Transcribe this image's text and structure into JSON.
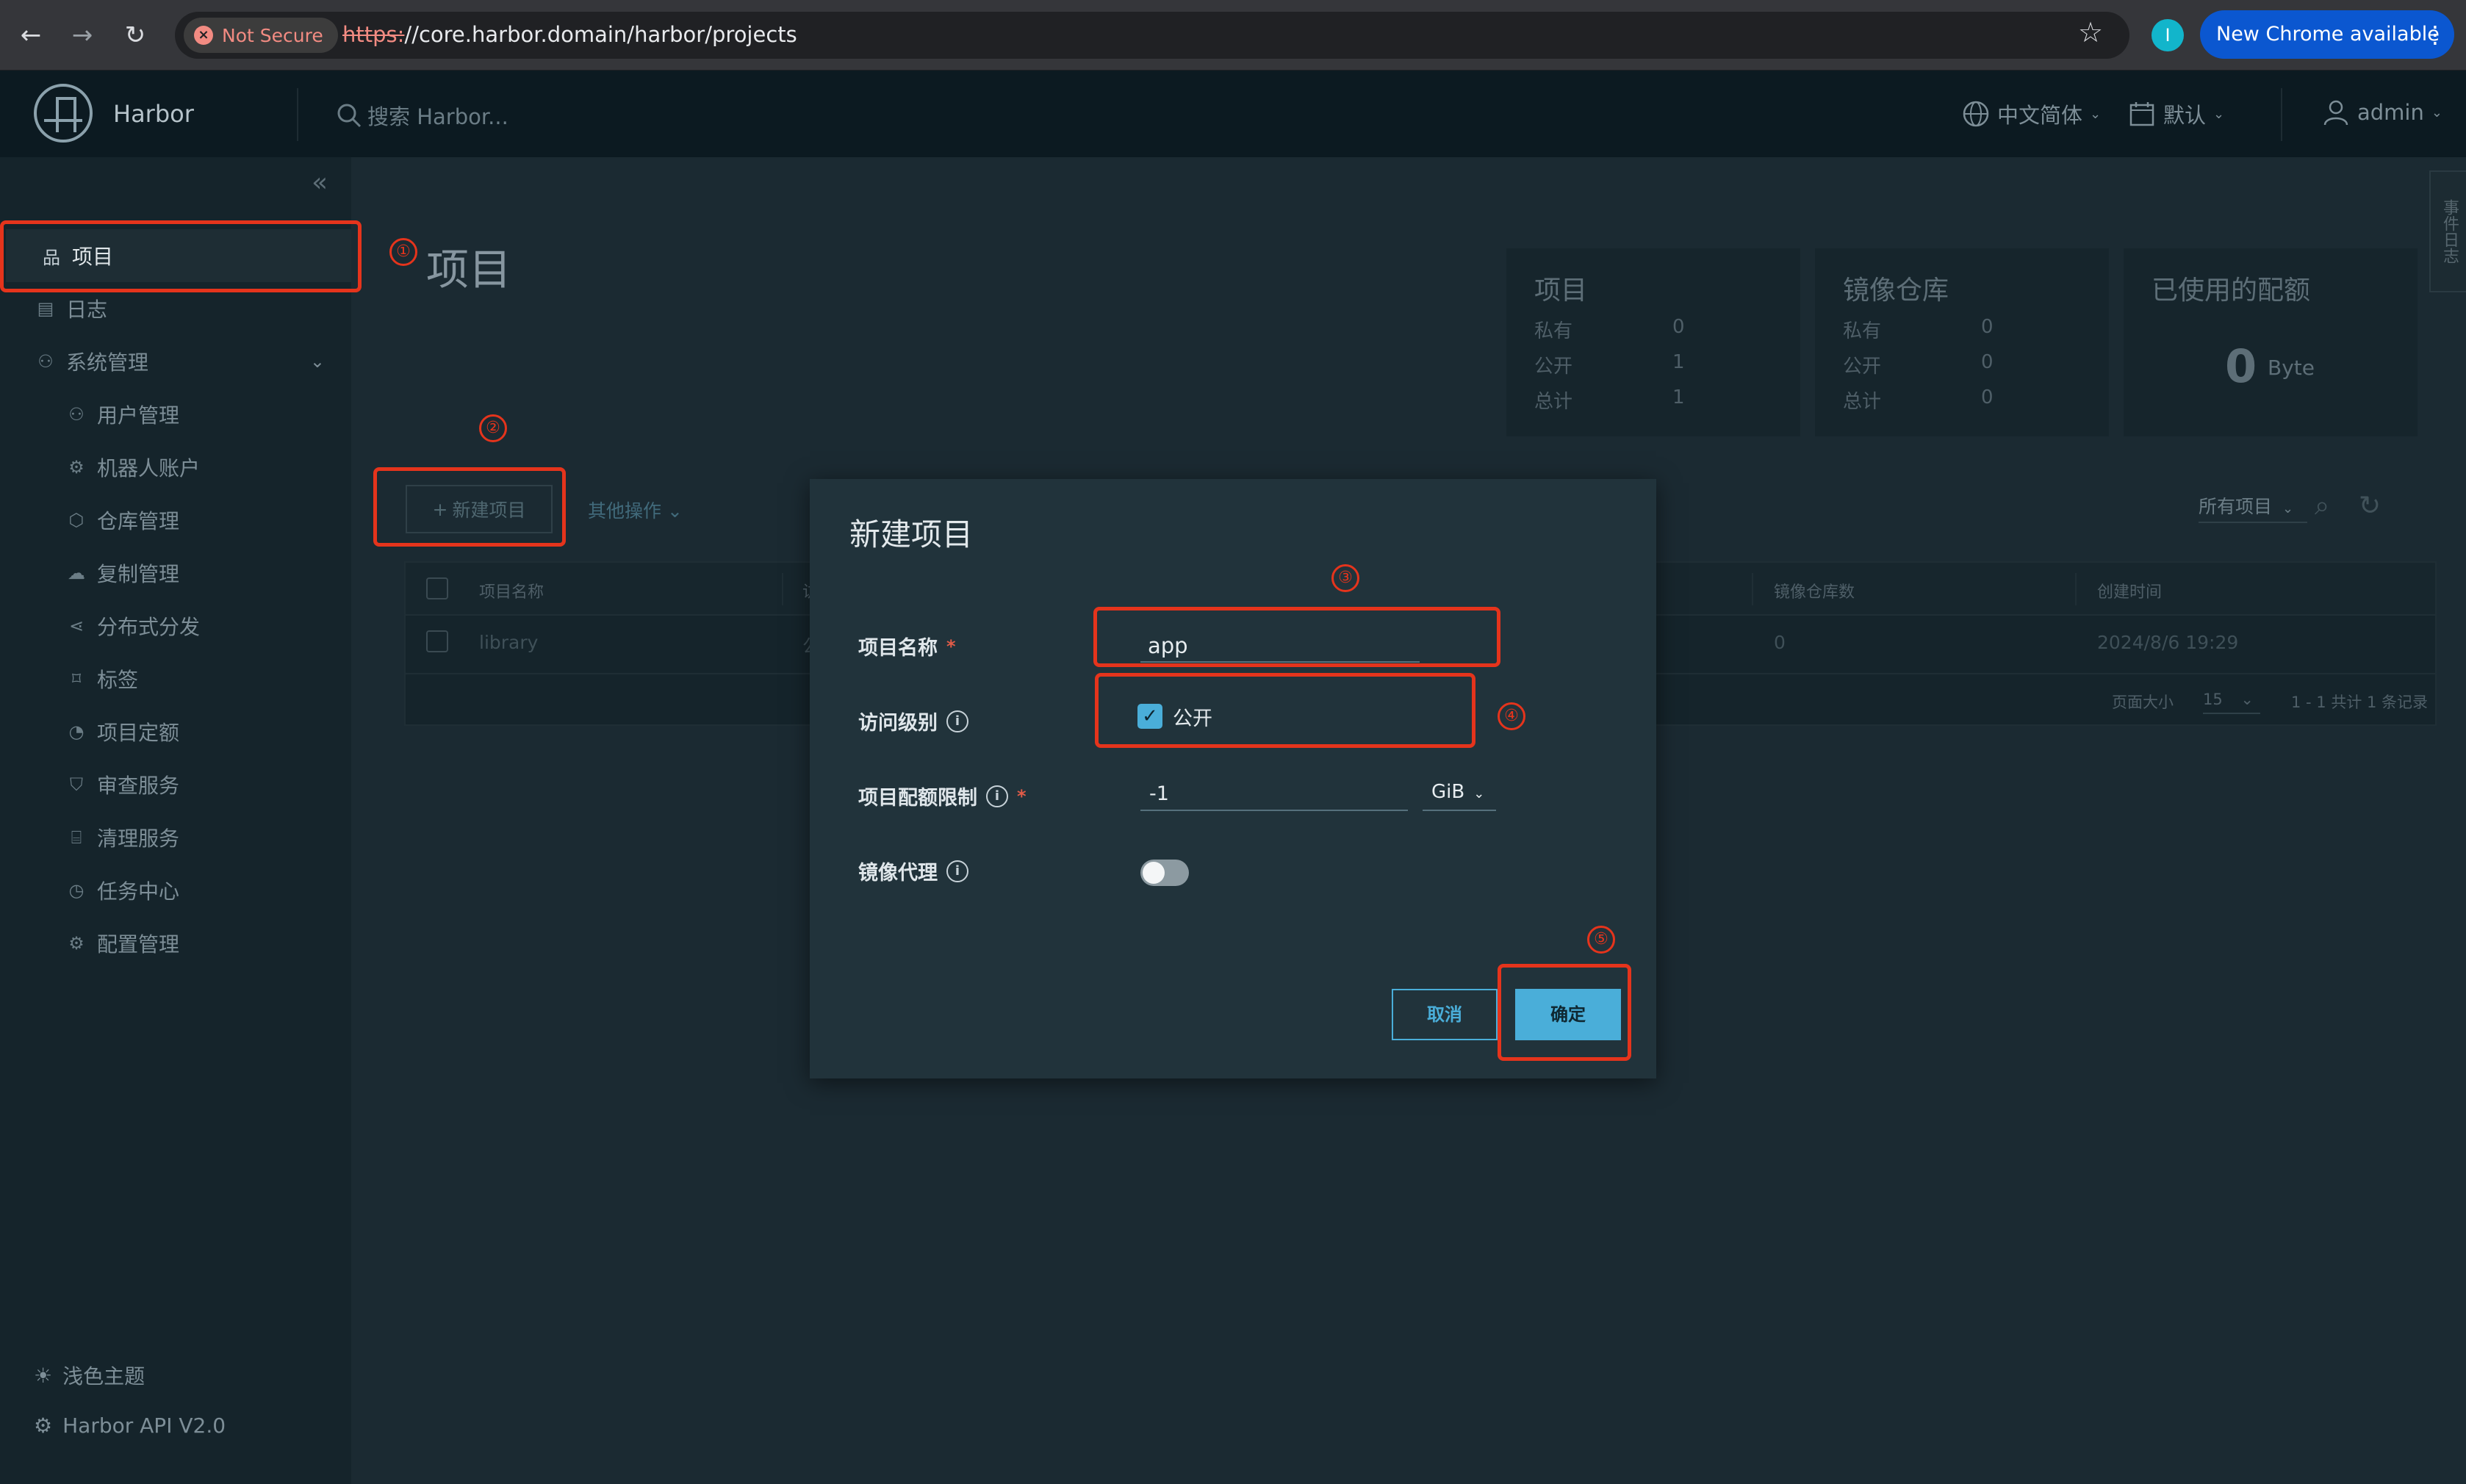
{
  "browser": {
    "security": "Not Secure",
    "url_scheme": "https:",
    "url_rest": "//core.harbor.domain/harbor/projects",
    "profile_initial": "I",
    "update_label": "New Chrome available",
    "nav_glyphs": {
      "back": "←",
      "forward": "→",
      "reload": "↻",
      "star": "☆",
      "kebab": "⋮"
    }
  },
  "header": {
    "brand": "Harbor",
    "search_placeholder": "搜索 Harbor...",
    "language": "中文简体",
    "datetime_format": "默认",
    "user": "admin"
  },
  "sidebar": {
    "collapse_glyph": "«",
    "items": [
      {
        "label": "项目",
        "icon": "projects-icon",
        "glyph": "品"
      },
      {
        "label": "日志",
        "icon": "logs-icon",
        "glyph": "▤"
      },
      {
        "label": "系统管理",
        "icon": "admin-icon",
        "glyph": "⚇"
      }
    ],
    "admin_caret": "⌄",
    "sub_items": [
      {
        "label": "用户管理",
        "icon": "users-icon",
        "glyph": "⚇"
      },
      {
        "label": "机器人账户",
        "icon": "robot-icon",
        "glyph": "⚙"
      },
      {
        "label": "仓库管理",
        "icon": "registries-icon",
        "glyph": "⬡"
      },
      {
        "label": "复制管理",
        "icon": "replication-icon",
        "glyph": "☁"
      },
      {
        "label": "分布式分发",
        "icon": "distribution-icon",
        "glyph": "⋖"
      },
      {
        "label": "标签",
        "icon": "tag-icon",
        "glyph": "⌑"
      },
      {
        "label": "项目定额",
        "icon": "quota-icon",
        "glyph": "◔"
      },
      {
        "label": "审查服务",
        "icon": "scanner-icon",
        "glyph": "⛉"
      },
      {
        "label": "清理服务",
        "icon": "gc-icon",
        "glyph": "⌸"
      },
      {
        "label": "任务中心",
        "icon": "jobs-icon",
        "glyph": "◷"
      },
      {
        "label": "配置管理",
        "icon": "config-icon",
        "glyph": "⚙"
      }
    ],
    "theme": {
      "label": "浅色主题",
      "glyph": "☀"
    },
    "api": {
      "label": "Harbor API V2.0",
      "glyph": "⚙"
    }
  },
  "main": {
    "title": "项目",
    "stats": {
      "projects": {
        "title": "项目",
        "private_label": "私有",
        "private": "0",
        "public_label": "公开",
        "public": "1",
        "total_label": "总计",
        "total": "1"
      },
      "repos": {
        "title": "镜像仓库",
        "private_label": "私有",
        "private": "0",
        "public_label": "公开",
        "public": "0",
        "total_label": "总计",
        "total": "0"
      },
      "quota": {
        "title": "已使用的配额",
        "value": "0",
        "unit": "Byte"
      }
    },
    "new_project_label": "新建项目",
    "plus_glyph": "+",
    "other_ops_label": "其他操作",
    "filter_label": "所有项目",
    "search_glyph": "⌕",
    "refresh_glyph": "↻",
    "table": {
      "headers": [
        "项目名称",
        "访",
        "镜像仓库数",
        "创建时间"
      ],
      "rows": [
        {
          "name": "library",
          "access_initial": "公",
          "repo_count": "0",
          "created": "2024/8/6 19:29"
        }
      ],
      "page_size_label": "页面大小",
      "page_size": "15",
      "summary": "1 - 1 共计 1 条记录"
    },
    "floater": "事件日志"
  },
  "modal": {
    "title": "新建项目",
    "name_label": "项目名称",
    "name_value": "app",
    "required_mark": "*",
    "access_label": "访问级别",
    "public_label": "公开",
    "public_checked": true,
    "check_glyph": "✓",
    "quota_label": "项目配额限制",
    "quota_value": "-1",
    "quota_unit": "GiB",
    "proxy_label": "镜像代理",
    "proxy_enabled": false,
    "info_glyph": "i",
    "cancel_label": "取消",
    "ok_label": "确定"
  },
  "annotations": {
    "numbers": [
      "①",
      "②",
      "③",
      "④",
      "⑤"
    ],
    "color": "#e5341c"
  },
  "colors": {
    "accent": "#4aaed9",
    "page_bg": "#1b2a32",
    "header_bg": "#0c1a21",
    "sidebar_bg": "#15242b",
    "modal_bg": "#21333b",
    "annotation": "#e5341c"
  }
}
